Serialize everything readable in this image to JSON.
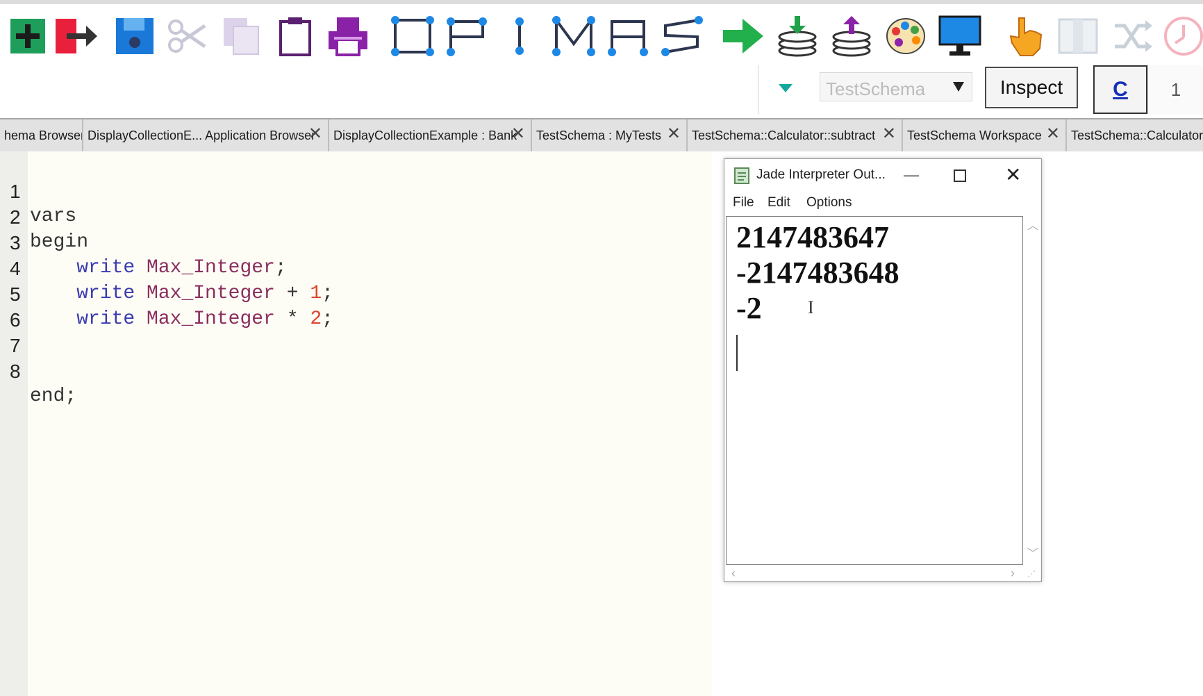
{
  "toolbar": {
    "icons": [
      "new-icon",
      "exit-icon",
      "save-icon",
      "cut-icon",
      "copy-icon",
      "paste-icon",
      "print-icon",
      "class-diagram-icon",
      "path-icon",
      "i-tool-icon",
      "m-tool-icon",
      "a-tool-icon",
      "s-tool-icon",
      "run-icon",
      "download-icon",
      "upload-icon",
      "palette-icon",
      "monitor-icon",
      "pointer-hand-icon",
      "panel-icon",
      "shuffle-icon",
      "history-icon"
    ],
    "schema_select": "TestSchema",
    "inspect_label": "Inspect",
    "c_label": "C",
    "one_label": "1"
  },
  "tabs": [
    {
      "label": "hema Browser",
      "closable": false
    },
    {
      "label": "DisplayCollectionE... Application Browser",
      "closable": true
    },
    {
      "label": "DisplayCollectionExample : Bank",
      "closable": true
    },
    {
      "label": "TestSchema : MyTests",
      "closable": true
    },
    {
      "label": "TestSchema::Calculator::subtract",
      "closable": true
    },
    {
      "label": "TestSchema Workspace",
      "closable": true
    },
    {
      "label": "TestSchema::Calculator:",
      "closable": false
    }
  ],
  "editor": {
    "lines": [
      {
        "n": "1",
        "kw": "vars"
      },
      {
        "n": "2",
        "kw": "begin"
      },
      {
        "n": "3",
        "indent": "    ",
        "write": "write",
        "id": "Max_Integer",
        "op": "",
        "num": "",
        "end": ";"
      },
      {
        "n": "4",
        "indent": "    ",
        "write": "write",
        "id": "Max_Integer",
        "op": " + ",
        "num": "1",
        "end": ";"
      },
      {
        "n": "5",
        "indent": "    ",
        "write": "write",
        "id": "Max_Integer",
        "op": " * ",
        "num": "2",
        "end": ";"
      },
      {
        "n": "6"
      },
      {
        "n": "7"
      },
      {
        "n": "8",
        "kw": "end;"
      }
    ]
  },
  "output_window": {
    "title": "Jade Interpreter Out...",
    "menu": [
      "File",
      "Edit",
      "Options"
    ],
    "lines": [
      "2147483647",
      "-2147483648",
      "-2"
    ]
  },
  "colors": {
    "editor_bg": "#fdfdf6",
    "keyword": "#333333",
    "write_kw": "#3b3bb0",
    "identifier": "#8b2e5e",
    "number": "#d8462e"
  }
}
